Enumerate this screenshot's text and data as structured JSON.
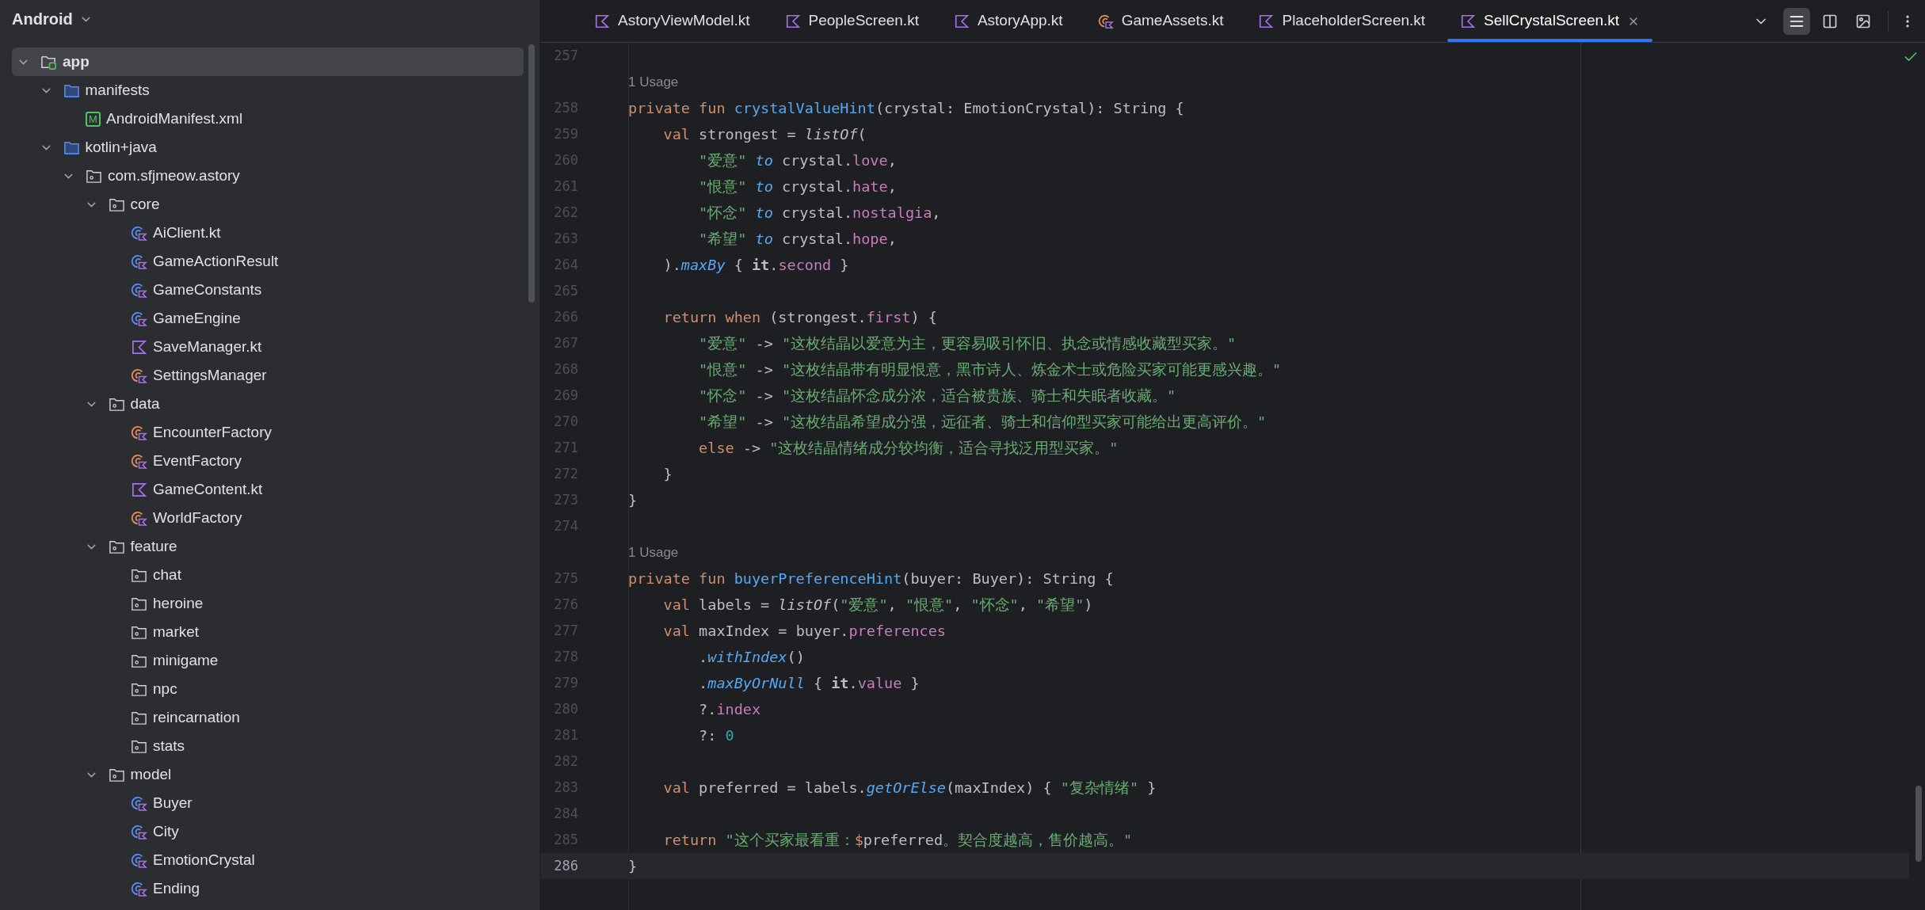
{
  "project_view": {
    "title": "Android",
    "tree": [
      {
        "label": "app",
        "kind": "module",
        "expanded": true,
        "selected": true,
        "children": [
          {
            "label": "manifests",
            "kind": "folder",
            "expanded": true,
            "selected": false,
            "children": [
              {
                "label": "AndroidManifest.xml",
                "kind": "manifest",
                "badge": "M",
                "selected": false
              }
            ]
          },
          {
            "label": "kotlin+java",
            "kind": "folder",
            "expanded": true,
            "selected": false,
            "children": [
              {
                "label": "com.sfjmeow.astory",
                "kind": "package",
                "expanded": true,
                "selected": false,
                "children": [
                  {
                    "label": "core",
                    "kind": "package",
                    "expanded": true,
                    "selected": false,
                    "children": [
                      {
                        "label": "AiClient.kt",
                        "kind": "class",
                        "selected": false
                      },
                      {
                        "label": "GameActionResult",
                        "kind": "class",
                        "selected": false
                      },
                      {
                        "label": "GameConstants",
                        "kind": "class",
                        "selected": false
                      },
                      {
                        "label": "GameEngine",
                        "kind": "class",
                        "selected": false
                      },
                      {
                        "label": "SaveManager.kt",
                        "kind": "kotlin",
                        "selected": false
                      },
                      {
                        "label": "SettingsManager",
                        "kind": "object",
                        "selected": false
                      }
                    ]
                  },
                  {
                    "label": "data",
                    "kind": "package",
                    "expanded": true,
                    "selected": false,
                    "children": [
                      {
                        "label": "EncounterFactory",
                        "kind": "object",
                        "selected": false
                      },
                      {
                        "label": "EventFactory",
                        "kind": "object",
                        "selected": false
                      },
                      {
                        "label": "GameContent.kt",
                        "kind": "kotlin",
                        "selected": false
                      },
                      {
                        "label": "WorldFactory",
                        "kind": "object",
                        "selected": false
                      }
                    ]
                  },
                  {
                    "label": "feature",
                    "kind": "package",
                    "expanded": true,
                    "selected": false,
                    "children": [
                      {
                        "label": "chat",
                        "kind": "package",
                        "selected": false
                      },
                      {
                        "label": "heroine",
                        "kind": "package",
                        "selected": false
                      },
                      {
                        "label": "market",
                        "kind": "package",
                        "selected": false
                      },
                      {
                        "label": "minigame",
                        "kind": "package",
                        "selected": false
                      },
                      {
                        "label": "npc",
                        "kind": "package",
                        "selected": false
                      },
                      {
                        "label": "reincarnation",
                        "kind": "package",
                        "selected": false
                      },
                      {
                        "label": "stats",
                        "kind": "package",
                        "selected": false
                      }
                    ]
                  },
                  {
                    "label": "model",
                    "kind": "package",
                    "expanded": true,
                    "selected": false,
                    "children": [
                      {
                        "label": "Buyer",
                        "kind": "class",
                        "selected": false
                      },
                      {
                        "label": "City",
                        "kind": "class",
                        "selected": false
                      },
                      {
                        "label": "EmotionCrystal",
                        "kind": "class",
                        "selected": false
                      },
                      {
                        "label": "Ending",
                        "kind": "class",
                        "selected": false
                      }
                    ]
                  }
                ]
              }
            ]
          }
        ]
      }
    ]
  },
  "tabs": [
    {
      "label": "AstoryViewModel.kt",
      "kind": "kotlin",
      "selected": false
    },
    {
      "label": "PeopleScreen.kt",
      "kind": "kotlin",
      "selected": false
    },
    {
      "label": "AstoryApp.kt",
      "kind": "kotlin",
      "selected": false
    },
    {
      "label": "GameAssets.kt",
      "kind": "object",
      "selected": false
    },
    {
      "label": "PlaceholderScreen.kt",
      "kind": "kotlin",
      "selected": false
    },
    {
      "label": "SellCrystalScreen.kt",
      "kind": "kotlin",
      "selected": true
    }
  ],
  "view_modes": [
    {
      "kind": "code",
      "selected": true
    },
    {
      "kind": "split",
      "selected": false
    },
    {
      "kind": "preview",
      "selected": false
    }
  ],
  "editor": {
    "lines": [
      {
        "kind": "code",
        "number": "257",
        "current": false
      },
      {
        "kind": "hint",
        "text": "1 Usage"
      },
      {
        "kind": "code",
        "number": "258",
        "current": false,
        "tokens": [
          {
            "kind": "kw",
            "text": "private fun "
          },
          {
            "kind": "fn",
            "text": "crystalValueHint"
          },
          {
            "kind": "plain",
            "text": "(crystal: EmotionCrystal): String {"
          }
        ]
      },
      {
        "kind": "code",
        "number": "259",
        "current": false,
        "tokens": [
          {
            "kind": "kw",
            "text": "    val "
          },
          {
            "kind": "plain",
            "text": "strongest = "
          },
          {
            "kind": "std",
            "text": "listOf"
          },
          {
            "kind": "plain",
            "text": "("
          }
        ]
      },
      {
        "kind": "code",
        "number": "260",
        "current": false,
        "tokens": [
          {
            "kind": "str",
            "text": "        \"爱意\""
          },
          {
            "kind": "call",
            "text": " to"
          },
          {
            "kind": "plain",
            "text": " crystal."
          },
          {
            "kind": "prop",
            "text": "love"
          },
          {
            "kind": "plain",
            "text": ","
          }
        ]
      },
      {
        "kind": "code",
        "number": "261",
        "current": false,
        "tokens": [
          {
            "kind": "str",
            "text": "        \"恨意\""
          },
          {
            "kind": "call",
            "text": " to"
          },
          {
            "kind": "plain",
            "text": " crystal."
          },
          {
            "kind": "prop",
            "text": "hate"
          },
          {
            "kind": "plain",
            "text": ","
          }
        ]
      },
      {
        "kind": "code",
        "number": "262",
        "current": false,
        "tokens": [
          {
            "kind": "str",
            "text": "        \"怀念\""
          },
          {
            "kind": "call",
            "text": " to"
          },
          {
            "kind": "plain",
            "text": " crystal."
          },
          {
            "kind": "prop",
            "text": "nostalgia"
          },
          {
            "kind": "plain",
            "text": ","
          }
        ]
      },
      {
        "kind": "code",
        "number": "263",
        "current": false,
        "tokens": [
          {
            "kind": "str",
            "text": "        \"希望\""
          },
          {
            "kind": "call",
            "text": " to"
          },
          {
            "kind": "plain",
            "text": " crystal."
          },
          {
            "kind": "prop",
            "text": "hope"
          },
          {
            "kind": "plain",
            "text": ","
          }
        ]
      },
      {
        "kind": "code",
        "number": "264",
        "current": false,
        "tokens": [
          {
            "kind": "plain",
            "text": "    )."
          },
          {
            "kind": "call",
            "text": "maxBy"
          },
          {
            "kind": "plain",
            "text": " { "
          },
          {
            "kind": "bold",
            "text": "it"
          },
          {
            "kind": "plain",
            "text": "."
          },
          {
            "kind": "prop",
            "text": "second"
          },
          {
            "kind": "plain",
            "text": " }"
          }
        ]
      },
      {
        "kind": "code",
        "number": "265",
        "current": false
      },
      {
        "kind": "code",
        "number": "266",
        "current": false,
        "tokens": [
          {
            "kind": "kw",
            "text": "    return when"
          },
          {
            "kind": "plain",
            "text": " (strongest."
          },
          {
            "kind": "prop",
            "text": "first"
          },
          {
            "kind": "plain",
            "text": ") {"
          }
        ]
      },
      {
        "kind": "code",
        "number": "267",
        "current": false,
        "tokens": [
          {
            "kind": "str",
            "text": "        \"爱意\""
          },
          {
            "kind": "plain",
            "text": " -> "
          },
          {
            "kind": "str",
            "text": "\"这枚结晶以爱意为主，更容易吸引怀旧、执念或情感收藏型买家。\""
          }
        ]
      },
      {
        "kind": "code",
        "number": "268",
        "current": false,
        "tokens": [
          {
            "kind": "str",
            "text": "        \"恨意\""
          },
          {
            "kind": "plain",
            "text": " -> "
          },
          {
            "kind": "str",
            "text": "\"这枚结晶带有明显恨意，黑市诗人、炼金术士或危险买家可能更感兴趣。\""
          }
        ]
      },
      {
        "kind": "code",
        "number": "269",
        "current": false,
        "tokens": [
          {
            "kind": "str",
            "text": "        \"怀念\""
          },
          {
            "kind": "plain",
            "text": " -> "
          },
          {
            "kind": "str",
            "text": "\"这枚结晶怀念成分浓，适合被贵族、骑士和失眠者收藏。\""
          }
        ]
      },
      {
        "kind": "code",
        "number": "270",
        "current": false,
        "tokens": [
          {
            "kind": "str",
            "text": "        \"希望\""
          },
          {
            "kind": "plain",
            "text": " -> "
          },
          {
            "kind": "str",
            "text": "\"这枚结晶希望成分强，远征者、骑士和信仰型买家可能给出更高评价。\""
          }
        ]
      },
      {
        "kind": "code",
        "number": "271",
        "current": false,
        "tokens": [
          {
            "kind": "kw",
            "text": "        else"
          },
          {
            "kind": "plain",
            "text": " -> "
          },
          {
            "kind": "str",
            "text": "\"这枚结晶情绪成分较均衡，适合寻找泛用型买家。\""
          }
        ]
      },
      {
        "kind": "code",
        "number": "272",
        "current": false,
        "tokens": [
          {
            "kind": "plain",
            "text": "    }"
          }
        ]
      },
      {
        "kind": "code",
        "number": "273",
        "current": false,
        "tokens": [
          {
            "kind": "plain",
            "text": "}"
          }
        ]
      },
      {
        "kind": "code",
        "number": "274",
        "current": false
      },
      {
        "kind": "hint",
        "text": "1 Usage"
      },
      {
        "kind": "code",
        "number": "275",
        "current": false,
        "tokens": [
          {
            "kind": "kw",
            "text": "private fun "
          },
          {
            "kind": "fn",
            "text": "buyerPreferenceHint"
          },
          {
            "kind": "plain",
            "text": "(buyer: Buyer): String {"
          }
        ]
      },
      {
        "kind": "code",
        "number": "276",
        "current": false,
        "tokens": [
          {
            "kind": "kw",
            "text": "    val "
          },
          {
            "kind": "plain",
            "text": "labels = "
          },
          {
            "kind": "std",
            "text": "listOf"
          },
          {
            "kind": "plain",
            "text": "("
          },
          {
            "kind": "str",
            "text": "\"爱意\""
          },
          {
            "kind": "plain",
            "text": ", "
          },
          {
            "kind": "str",
            "text": "\"恨意\""
          },
          {
            "kind": "plain",
            "text": ", "
          },
          {
            "kind": "str",
            "text": "\"怀念\""
          },
          {
            "kind": "plain",
            "text": ", "
          },
          {
            "kind": "str",
            "text": "\"希望\""
          },
          {
            "kind": "plain",
            "text": ")"
          }
        ]
      },
      {
        "kind": "code",
        "number": "277",
        "current": false,
        "tokens": [
          {
            "kind": "kw",
            "text": "    val "
          },
          {
            "kind": "plain",
            "text": "maxIndex = buyer."
          },
          {
            "kind": "prop",
            "text": "preferences"
          }
        ]
      },
      {
        "kind": "code",
        "number": "278",
        "current": false,
        "tokens": [
          {
            "kind": "plain",
            "text": "        ."
          },
          {
            "kind": "call",
            "text": "withIndex"
          },
          {
            "kind": "plain",
            "text": "()"
          }
        ]
      },
      {
        "kind": "code",
        "number": "279",
        "current": false,
        "tokens": [
          {
            "kind": "plain",
            "text": "        ."
          },
          {
            "kind": "call",
            "text": "maxByOrNull"
          },
          {
            "kind": "plain",
            "text": " { "
          },
          {
            "kind": "bold",
            "text": "it"
          },
          {
            "kind": "plain",
            "text": "."
          },
          {
            "kind": "prop",
            "text": "value"
          },
          {
            "kind": "plain",
            "text": " }"
          }
        ]
      },
      {
        "kind": "code",
        "number": "280",
        "current": false,
        "tokens": [
          {
            "kind": "plain",
            "text": "        ?."
          },
          {
            "kind": "prop",
            "text": "index"
          }
        ]
      },
      {
        "kind": "code",
        "number": "281",
        "current": false,
        "tokens": [
          {
            "kind": "plain",
            "text": "        ?: "
          },
          {
            "kind": "num",
            "text": "0"
          }
        ]
      },
      {
        "kind": "code",
        "number": "282",
        "current": false
      },
      {
        "kind": "code",
        "number": "283",
        "current": false,
        "tokens": [
          {
            "kind": "kw",
            "text": "    val "
          },
          {
            "kind": "plain",
            "text": "preferred = labels."
          },
          {
            "kind": "call",
            "text": "getOrElse"
          },
          {
            "kind": "plain",
            "text": "(maxIndex) { "
          },
          {
            "kind": "str",
            "text": "\"复杂情绪\""
          },
          {
            "kind": "plain",
            "text": " }"
          }
        ]
      },
      {
        "kind": "code",
        "number": "284",
        "current": false
      },
      {
        "kind": "code",
        "number": "285",
        "current": false,
        "tokens": [
          {
            "kind": "kw",
            "text": "    return "
          },
          {
            "kind": "str",
            "text": "\"这个买家最看重："
          },
          {
            "kind": "kw",
            "text": "$"
          },
          {
            "kind": "plain",
            "text": "preferred"
          },
          {
            "kind": "str",
            "text": "。契合度越高，售价越高。\""
          }
        ]
      },
      {
        "kind": "code",
        "number": "286",
        "current": true,
        "tokens": [
          {
            "kind": "plain",
            "text": "}"
          }
        ]
      }
    ]
  }
}
